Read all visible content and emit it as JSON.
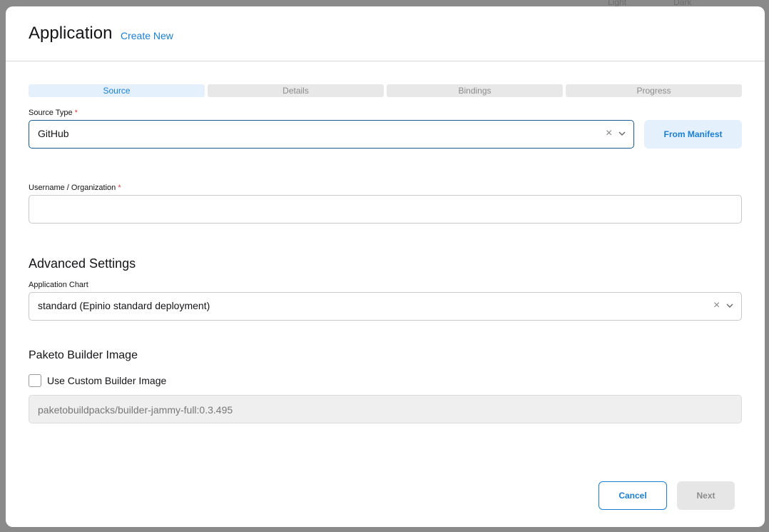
{
  "modal": {
    "title": "Application",
    "create_new": "Create New"
  },
  "steps": [
    {
      "label": "Source",
      "active": true
    },
    {
      "label": "Details",
      "active": false
    },
    {
      "label": "Bindings",
      "active": false
    },
    {
      "label": "Progress",
      "active": false
    }
  ],
  "source_type": {
    "label": "Source Type",
    "required_mark": "*",
    "value": "GitHub"
  },
  "from_manifest": "From Manifest",
  "username": {
    "label": "Username / Organization",
    "required_mark": "*",
    "value": ""
  },
  "advanced": {
    "title": "Advanced Settings",
    "chart_label": "Application Chart",
    "chart_value": "standard (Epinio standard deployment)"
  },
  "paketo": {
    "title": "Paketo Builder Image",
    "checkbox_label": "Use Custom Builder Image",
    "checked": false,
    "image_value": "paketobuildpacks/builder-jammy-full:0.3.495"
  },
  "footer": {
    "cancel": "Cancel",
    "next": "Next"
  },
  "colors": {
    "accent": "#1a7fd4",
    "active_step_bg": "#e4f1fc",
    "required": "#d43d3d"
  }
}
